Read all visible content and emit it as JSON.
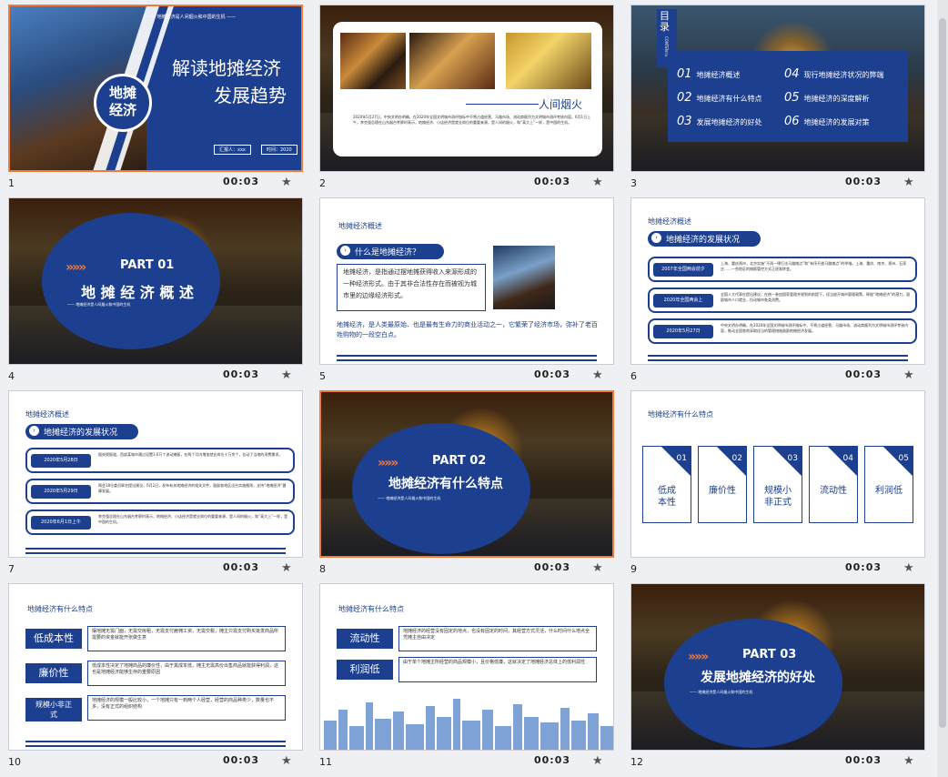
{
  "slides": [
    {
      "num": "1",
      "dur": "00:03"
    },
    {
      "num": "2",
      "dur": "00:03"
    },
    {
      "num": "3",
      "dur": "00:03"
    },
    {
      "num": "4",
      "dur": "00:03"
    },
    {
      "num": "5",
      "dur": "00:03"
    },
    {
      "num": "6",
      "dur": "00:03"
    },
    {
      "num": "7",
      "dur": "00:03"
    },
    {
      "num": "8",
      "dur": "00:03"
    },
    {
      "num": "9",
      "dur": "00:03"
    },
    {
      "num": "10",
      "dur": "00:03"
    },
    {
      "num": "11",
      "dur": "00:03"
    },
    {
      "num": "12",
      "dur": "00:03"
    }
  ],
  "s1": {
    "banner": "—— 地摊经济是人间烟火和中国的生机 ——",
    "logo1": "地摊",
    "logo2": "经济",
    "title1": "解读地摊经济",
    "title2": "发展趋势",
    "reporter": "汇报人：xxx",
    "date": "时间：2020"
  },
  "s2": {
    "caption": "人间烟火",
    "body": "2020年5月27日，中央文明办明确，在2020年全国文明城市测评指标中不将占道经营、马路市场、流动商贩列为文明城市测评考核内容。6月1日上午，李克强总理在山东烟台考察时表示，地摊经济、小店经济是就业岗位的重要来源，是人间的烟火，和“高大上”一样，是中国的生机。"
  },
  "s3": {
    "mu": "目录",
    "contents": "CONTENTS",
    "items": [
      {
        "n": "01",
        "t": "地摊经济概述"
      },
      {
        "n": "04",
        "t": "现行地摊经济状况的弊端"
      },
      {
        "n": "02",
        "t": "地摊经济有什么特点"
      },
      {
        "n": "05",
        "t": "地摊经济的深度解析"
      },
      {
        "n": "03",
        "t": "发展地摊经济的好处"
      },
      {
        "n": "06",
        "t": "地摊经济的发展对策"
      }
    ]
  },
  "s4": {
    "arrows": "»»»",
    "part": "PART 01",
    "title": "地 摊 经 济 概 述",
    "sub": "—— 地摊经济是人间烟火和中国的生机"
  },
  "s5": {
    "section": "地摊经济概述",
    "q": "什么是地摊经济？",
    "def": "地摊经济，是指通过摆地摊获得收入来源形成的一种经济形式。由于其非合法性存在而被视为城市里的边缘经济形式。",
    "bottom": "地摊经济，是人类最原始、也是最有生命力的商业活动之一，它繁荣了经济市场，弥补了老百姓购物的一段空白点。"
  },
  "s6": {
    "section": "地摊经济概述",
    "head": "地摊经济的发展状况",
    "rows": [
      {
        "tag": "2007年全国两会前夕",
        "txt": "上海、重庆两市，北京实施“不再一律打击马路摊点”和“有序开放马路摊点”的举措。上海、重庆、南京、郑州、石家庄……一些地区的摊贩管控方式正逐渐转变。"
      },
      {
        "tag": "2020年全国两会上",
        "txt": "全国人大代表在提出建议，在统一参加国家管理并规划的前提下，适当放开城市管理政策，释放“地摊经济”的潜力，鼓励城市人口就业，拉动城市各类消费。"
      },
      {
        "tag": "2020年5月27日",
        "txt": "中央文明办明确，在2020年全国文明城市测评指标中，不将占道经营、马路市场、流动商贩列为文明城市测评考核内容，推动全国各地采取适当的管理措施鼓励地摊经济发展。"
      }
    ]
  },
  "s7": {
    "section": "地摊经济概述",
    "head": "地摊经济的发展状况",
    "rows": [
      {
        "tag": "2020年5月28日",
        "txt": "据央视报道，西部某城市通过设置3.6万个流动摊贩，在两个月内增加就业岗位十万余个，拉动了当地的消费需求。"
      },
      {
        "tag": "2020年5月29日",
        "txt": "两会18位委员联名提出建议，6月2日，发布有关地摊经济的相关文件，鼓励各地区出台实施细则，支持“地摊经济”健康发展。"
      },
      {
        "tag": "2020年6月1日上午",
        "txt": "李克强总理在山东烟台考察时表示，地摊经济、小店经济是就业岗位的重要来源，是人间的烟火，和“高大上”一样，是中国的生机。"
      }
    ]
  },
  "s8": {
    "arrows": "»»»",
    "part": "PART 02",
    "title": "地摊经济有什么特点",
    "sub": "—— 地摊经济是人间烟火和中国的生机"
  },
  "s9": {
    "section": "地摊经济有什么特点",
    "cards": [
      {
        "n": "01",
        "l1": "低成",
        "l2": "本性"
      },
      {
        "n": "02",
        "l1": "廉价性",
        "l2": ""
      },
      {
        "n": "03",
        "l1": "规模小",
        "l2": "非正式"
      },
      {
        "n": "04",
        "l1": "流动性",
        "l2": ""
      },
      {
        "n": "05",
        "l1": "利润低",
        "l2": ""
      }
    ]
  },
  "s10": {
    "section": "地摊经济有什么特点",
    "rows": [
      {
        "f": "低成本性",
        "d": "摆地摊无需门面，无需交房租，无需支付雇佣工资，无需交税，摊主只需支付购买批发商品所需要的资金就能开张做生意"
      },
      {
        "f": "廉价性",
        "d": "低成本性决定了地摊商品的廉价性，由于其成本低，摊主无需高价出售商品就能获得利润，这也是地摊经济能够生存的重要原因"
      },
      {
        "f": "规模小非正式",
        "d": "地摊经济的规模一般比较小，一个地摊只有一到两个人经营，经营的商品种类少，数量也不多，没有正式的组织结构"
      }
    ]
  },
  "s11": {
    "section": "地摊经济有什么特点",
    "rows": [
      {
        "f": "流动性",
        "d": "地摊经济的经营没有固定的地点，也没有固定的时间，其经营方式灵活，什么时间什么地点全凭摊主自由决定"
      },
      {
        "f": "利润低",
        "d": "由于单个地摊主所经营的商品规模小，且价格低廉，这就决定了地摊经济总体上的低利润性"
      }
    ]
  },
  "s12": {
    "arrows": "»»»",
    "part": "PART 03",
    "title": "发展地摊经济的好处",
    "sub": "—— 地摊经济是人间烟火和中国的生机"
  }
}
